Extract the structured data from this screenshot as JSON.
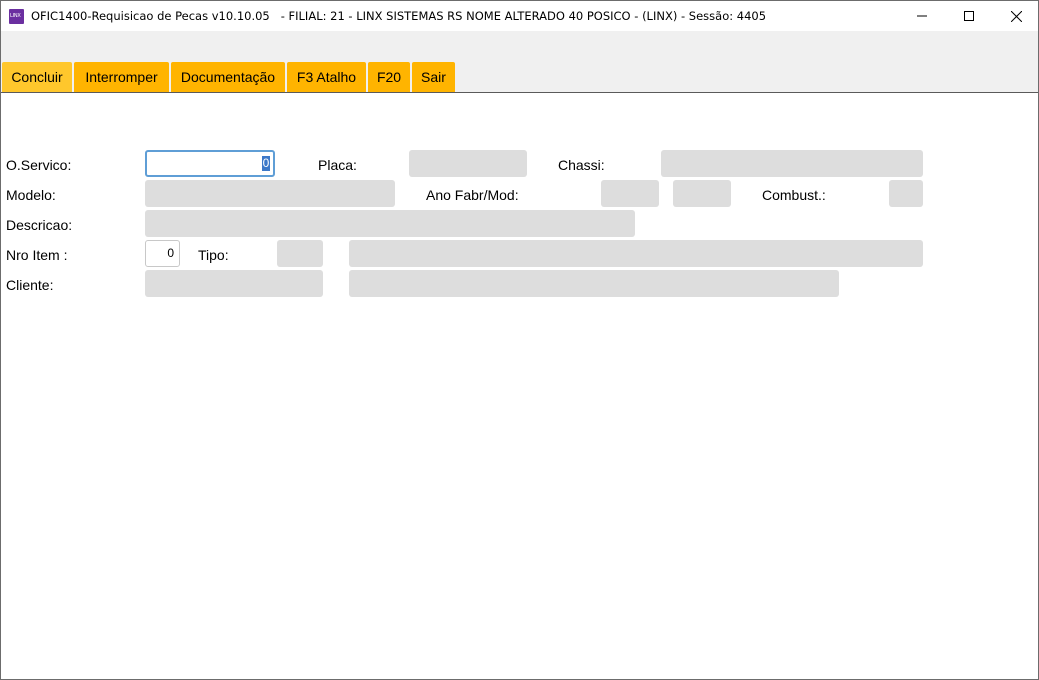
{
  "window": {
    "title": "OFIC1400-Requisicao de Pecas v10.10.05   - FILIAL: 21 - LINX SISTEMAS RS NOME ALTERADO 40 POSICO - (LINX) - Sessão: 4405",
    "icon_text": "LINX",
    "controls": {
      "minimize": "—",
      "maximize": "☐",
      "close": "✕"
    }
  },
  "toolbar": {
    "buttons": [
      {
        "label": "Concluir"
      },
      {
        "label": "Interromper"
      },
      {
        "label": "Documentação"
      },
      {
        "label": "F3 Atalho"
      },
      {
        "label": "F20"
      },
      {
        "label": "Sair"
      }
    ],
    "active_color": "#ffc72c",
    "button_color": "#ffb400"
  },
  "form": {
    "o_servico": {
      "label": "O.Servico:",
      "value": "0"
    },
    "placa": {
      "label": "Placa:",
      "value": ""
    },
    "chassi": {
      "label": "Chassi:",
      "value": ""
    },
    "modelo": {
      "label": "Modelo:",
      "value": ""
    },
    "ano_fabr_mod": {
      "label": "Ano Fabr/Mod:",
      "fabr": "",
      "mod": ""
    },
    "combust": {
      "label": "Combust.:",
      "value": ""
    },
    "descricao": {
      "label": "Descricao:",
      "value": ""
    },
    "nro_item": {
      "label": "Nro Item :",
      "value": "0"
    },
    "tipo": {
      "label": "Tipo:",
      "code": "",
      "desc": ""
    },
    "cliente": {
      "label": "Cliente:",
      "code": "",
      "name": ""
    }
  }
}
